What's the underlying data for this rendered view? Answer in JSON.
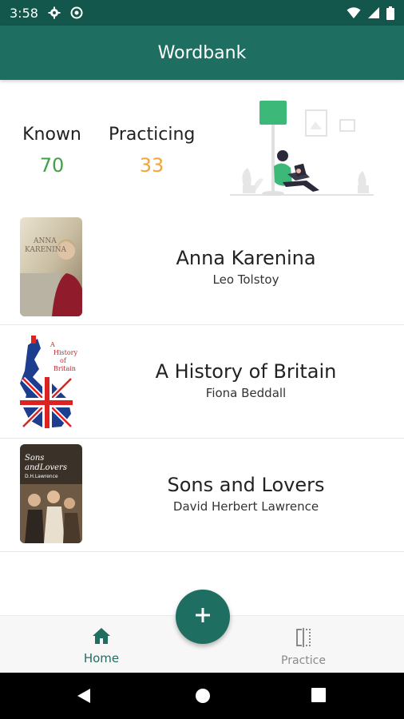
{
  "status_bar": {
    "time": "3:58",
    "icons": [
      "settings-icon",
      "vpn-icon",
      "wifi-icon",
      "signal-icon",
      "battery-icon"
    ]
  },
  "app_bar": {
    "title": "Wordbank"
  },
  "stats": {
    "known_label": "Known",
    "known_value": "70",
    "practicing_label": "Practicing",
    "practicing_value": "33",
    "colors": {
      "known": "#43a047",
      "practicing": "#f2a53a"
    }
  },
  "books": [
    {
      "title": "Anna Karenina",
      "author": "Leo Tolstoy",
      "cover_text": "ANNA KARENINA"
    },
    {
      "title": "A History of Britain",
      "author": "Fiona Beddall",
      "cover_text": "A History of Britain"
    },
    {
      "title": "Sons and Lovers",
      "author": "David Herbert Lawrence",
      "cover_text": "Sons and Lovers"
    }
  ],
  "fab": {
    "icon": "plus-icon"
  },
  "bottom_nav": {
    "home_label": "Home",
    "practice_label": "Practice"
  },
  "colors": {
    "primary": "#1f6e62",
    "status_bar": "#13574c"
  }
}
